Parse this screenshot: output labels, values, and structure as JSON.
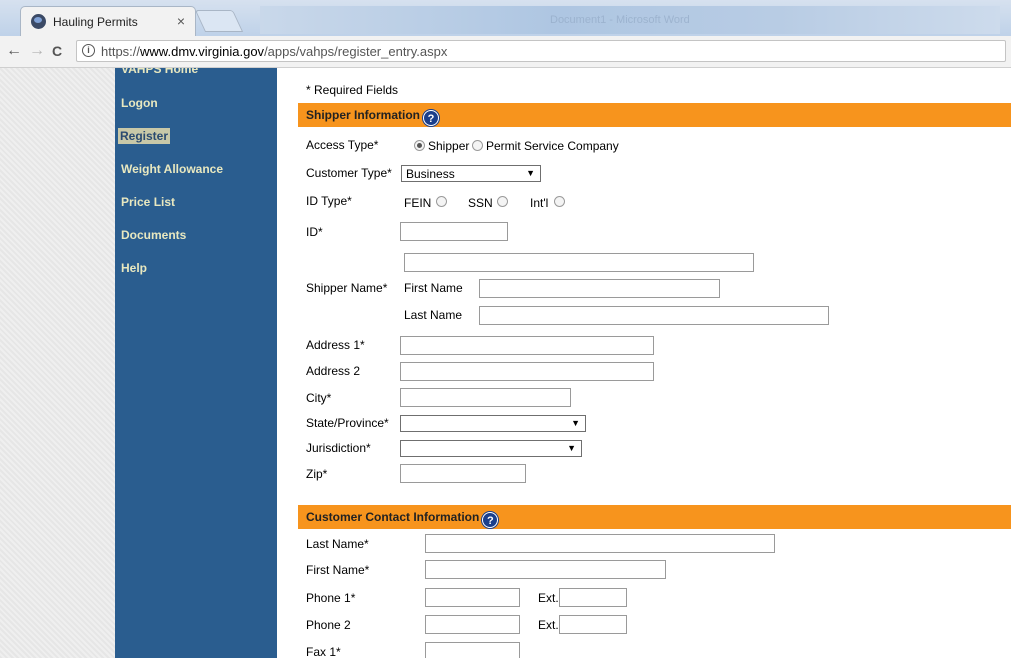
{
  "browser": {
    "tab_title": "Hauling Permits",
    "tab_close": "×",
    "blurred_title": "Document1 - Microsoft Word",
    "url_scheme": "https://",
    "url_host": "www.dmv.virginia.gov",
    "url_path": "/apps/vahps/register_entry.aspx",
    "back": "←",
    "forward": "→",
    "reload": "C",
    "info": "i"
  },
  "sidebar": {
    "items": [
      {
        "label": "VAHPS Home"
      },
      {
        "label": "Logon"
      },
      {
        "label": "Register"
      },
      {
        "label": "Weight Allowance"
      },
      {
        "label": "Price List"
      },
      {
        "label": "Documents"
      },
      {
        "label": "Help"
      }
    ]
  },
  "form": {
    "required_note": "* Required Fields",
    "help_glyph": "?",
    "shipper": {
      "heading": "Shipper Information",
      "access_type_label": "Access Type*",
      "access_options": [
        "Shipper",
        "Permit Service Company"
      ],
      "access_selected": "Shipper",
      "customer_type_label": "Customer Type*",
      "customer_type_value": "Business",
      "id_type_label": "ID Type*",
      "id_type_options": [
        "FEIN",
        "SSN",
        "Int'l"
      ],
      "id_label": "ID*",
      "shipper_name_label": "Shipper Name*",
      "first_name_label": "First Name",
      "last_name_label": "Last Name",
      "address1_label": "Address 1*",
      "address2_label": "Address 2",
      "city_label": "City*",
      "state_label": "State/Province*",
      "jurisdiction_label": "Jurisdiction*",
      "zip_label": "Zip*"
    },
    "contact": {
      "heading": "Customer Contact Information",
      "last_name_label": "Last Name*",
      "first_name_label": "First Name*",
      "phone1_label": "Phone 1*",
      "phone2_label": "Phone 2",
      "ext_label": "Ext.",
      "fax1_label": "Fax 1*"
    }
  },
  "colors": {
    "sidebar": "#2a5d8f",
    "section_header": "#f7941d"
  }
}
